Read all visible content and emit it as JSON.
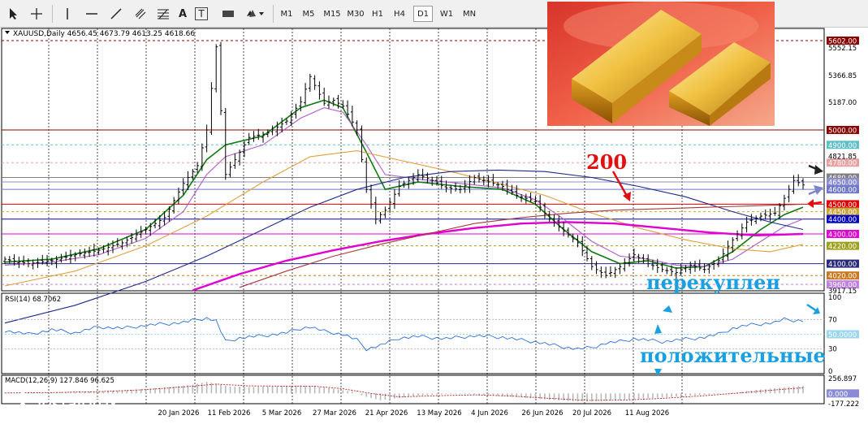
{
  "toolbar": {
    "tools": [
      "cursor-icon",
      "crosshair-icon",
      "vertical-line-icon",
      "horizontal-line-icon",
      "trendline-icon",
      "channel-icon",
      "fibonacci-icon",
      "text-icon",
      "text-label-icon",
      "shapes-icon",
      "arrows-icon"
    ],
    "text_tool": "A",
    "label_tool": "T",
    "timeframes": [
      "M1",
      "M5",
      "M15",
      "M30",
      "H1",
      "H4",
      "D1",
      "W1",
      "MN"
    ],
    "active_timeframe": "D1"
  },
  "header": {
    "symbol_text": "XAUUSD,Daily  4656.45 4673.79 4613.25 4618.66",
    "rsi_text": "RSI(14) 68.7062",
    "macd_text": "MACD(12,26,9) 127.846 96.625"
  },
  "annotations": {
    "ma_label": "200",
    "overbought": "перекуплен",
    "positive": "положительные"
  },
  "logo": {
    "title": "instaforex",
    "subtitle": "Instant Forex Trading"
  },
  "colors": {
    "ohlc": "#000000",
    "ema_fast": "#0f7a0f",
    "ema_slow": "#b15cc9",
    "sma_orange": "#e0a040",
    "ma200_blue": "#1c2a8a",
    "ma_magenta": "#e000d0",
    "ma_brown": "#a83a3a",
    "rsi_line": "#2a6fd6",
    "macd_signal": "#b22222",
    "annot_red": "#e01010",
    "annot_blue": "#1aa0e0"
  },
  "chart_data": {
    "type": "line",
    "symbol": "XAUUSD",
    "timeframe": "Daily",
    "x_axis_labels": [
      "20 Jan 2026",
      "11 Feb 2026",
      "5 Mar 2026",
      "27 Mar 2026",
      "21 Apr 2026",
      "13 May 2026",
      "4 Jun 2026",
      "26 Jun 2026",
      "20 Jul 2026",
      "11 Aug 2026"
    ],
    "ylim": [
      3917.15,
      5640
    ],
    "y_tick_labels": [
      "5552.15",
      "5366.85",
      "5187.00",
      "4821.85",
      "3917.15"
    ],
    "levels": [
      {
        "label": "5602.00",
        "value": 5602,
        "color": "#8b0000",
        "bg": "#8b0000",
        "style": "dash"
      },
      {
        "label": "5000.00",
        "value": 5000,
        "color": "#8b0000",
        "bg": "#8b0000",
        "style": "solid"
      },
      {
        "label": "4900.00",
        "value": 4900,
        "color": "#5fc0c8",
        "bg": "#5fc0c8",
        "style": "dash"
      },
      {
        "label": "4780.00",
        "value": 4780,
        "color": "#e8a0a0",
        "bg": "#e8a0a0",
        "style": "dash"
      },
      {
        "label": "4680.00",
        "value": 4680,
        "color": "#808080",
        "bg": "#808080",
        "style": "solid"
      },
      {
        "label": "4650.00",
        "value": 4650,
        "color": "#8c8cd0",
        "bg": "#8c8cd0",
        "style": "solid"
      },
      {
        "label": "4600.00",
        "value": 4600,
        "color": "#6f77c8",
        "bg": "#6f77c8",
        "style": "solid"
      },
      {
        "label": "4500.00",
        "value": 4500,
        "color": "#e00000",
        "bg": "#e00000",
        "style": "solid"
      },
      {
        "label": "4450.00",
        "value": 4450,
        "color": "#c9a63b",
        "bg": "#c9a63b",
        "style": "dash"
      },
      {
        "label": "4400.00",
        "value": 4400,
        "color": "#0000c0",
        "bg": "#0000c0",
        "style": "solid"
      },
      {
        "label": "4300.00",
        "value": 4300,
        "color": "#e000d0",
        "bg": "#e000d0",
        "style": "solid"
      },
      {
        "label": "4220.00",
        "value": 4220,
        "color": "#a0a020",
        "bg": "#a0a020",
        "style": "dash"
      },
      {
        "label": "4100.00",
        "value": 4100,
        "color": "#2a2a7a",
        "bg": "#2a2a7a",
        "style": "solid"
      },
      {
        "label": "4020.00",
        "value": 4020,
        "color": "#c97a20",
        "bg": "#c97a20",
        "style": "dash"
      },
      {
        "label": "3960.00",
        "value": 3960,
        "color": "#c080e0",
        "bg": "#c080e0",
        "style": "dash"
      }
    ],
    "close_path": [
      [
        0,
        4130
      ],
      [
        5,
        4100
      ],
      [
        10,
        4120
      ],
      [
        15,
        4160
      ],
      [
        20,
        4190
      ],
      [
        25,
        4240
      ],
      [
        30,
        4330
      ],
      [
        34,
        4410
      ],
      [
        38,
        4640
      ],
      [
        41,
        4760
      ],
      [
        43,
        5000
      ],
      [
        45,
        5560
      ],
      [
        47,
        4700
      ],
      [
        49,
        4800
      ],
      [
        52,
        4950
      ],
      [
        56,
        4980
      ],
      [
        60,
        5060
      ],
      [
        63,
        5190
      ],
      [
        65,
        5360
      ],
      [
        68,
        5180
      ],
      [
        70,
        5200
      ],
      [
        72,
        5160
      ],
      [
        75,
        5000
      ],
      [
        77,
        4600
      ],
      [
        79,
        4400
      ],
      [
        81,
        4460
      ],
      [
        84,
        4620
      ],
      [
        88,
        4700
      ],
      [
        91,
        4660
      ],
      [
        94,
        4610
      ],
      [
        97,
        4600
      ],
      [
        100,
        4680
      ],
      [
        103,
        4650
      ],
      [
        106,
        4620
      ],
      [
        109,
        4560
      ],
      [
        113,
        4520
      ],
      [
        116,
        4400
      ],
      [
        119,
        4320
      ],
      [
        122,
        4240
      ],
      [
        125,
        4080
      ],
      [
        128,
        4020
      ],
      [
        131,
        4080
      ],
      [
        134,
        4160
      ],
      [
        137,
        4100
      ],
      [
        140,
        4060
      ],
      [
        143,
        4040
      ],
      [
        146,
        4090
      ],
      [
        149,
        4060
      ],
      [
        152,
        4120
      ],
      [
        155,
        4260
      ],
      [
        158,
        4380
      ],
      [
        161,
        4420
      ],
      [
        164,
        4440
      ],
      [
        166,
        4540
      ],
      [
        168,
        4660
      ],
      [
        170,
        4630
      ]
    ],
    "series": [
      {
        "name": "EMA fast",
        "color": "#0f7a0f",
        "points": [
          [
            0,
            4110
          ],
          [
            10,
            4130
          ],
          [
            20,
            4200
          ],
          [
            30,
            4330
          ],
          [
            38,
            4560
          ],
          [
            43,
            4800
          ],
          [
            47,
            4900
          ],
          [
            55,
            4960
          ],
          [
            63,
            5150
          ],
          [
            68,
            5200
          ],
          [
            72,
            5150
          ],
          [
            77,
            4850
          ],
          [
            81,
            4600
          ],
          [
            88,
            4650
          ],
          [
            97,
            4620
          ],
          [
            106,
            4600
          ],
          [
            113,
            4500
          ],
          [
            119,
            4330
          ],
          [
            125,
            4180
          ],
          [
            131,
            4100
          ],
          [
            137,
            4120
          ],
          [
            143,
            4070
          ],
          [
            149,
            4080
          ],
          [
            155,
            4180
          ],
          [
            161,
            4330
          ],
          [
            166,
            4430
          ],
          [
            170,
            4480
          ]
        ]
      },
      {
        "name": "EMA slow",
        "color": "#b15cc9",
        "points": [
          [
            0,
            4090
          ],
          [
            10,
            4110
          ],
          [
            20,
            4160
          ],
          [
            30,
            4270
          ],
          [
            38,
            4450
          ],
          [
            43,
            4700
          ],
          [
            47,
            4820
          ],
          [
            55,
            4900
          ],
          [
            63,
            5080
          ],
          [
            68,
            5150
          ],
          [
            72,
            5120
          ],
          [
            77,
            4900
          ],
          [
            81,
            4700
          ],
          [
            88,
            4670
          ],
          [
            97,
            4640
          ],
          [
            106,
            4610
          ],
          [
            113,
            4530
          ],
          [
            119,
            4400
          ],
          [
            125,
            4250
          ],
          [
            131,
            4150
          ],
          [
            137,
            4130
          ],
          [
            143,
            4090
          ],
          [
            149,
            4080
          ],
          [
            155,
            4130
          ],
          [
            161,
            4250
          ],
          [
            166,
            4350
          ],
          [
            170,
            4400
          ]
        ]
      },
      {
        "name": "SMA orange",
        "color": "#e0a040",
        "points": [
          [
            0,
            3950
          ],
          [
            15,
            4050
          ],
          [
            30,
            4220
          ],
          [
            43,
            4420
          ],
          [
            55,
            4650
          ],
          [
            65,
            4820
          ],
          [
            75,
            4860
          ],
          [
            85,
            4790
          ],
          [
            95,
            4720
          ],
          [
            105,
            4640
          ],
          [
            115,
            4560
          ],
          [
            125,
            4440
          ],
          [
            135,
            4340
          ],
          [
            145,
            4260
          ],
          [
            155,
            4200
          ],
          [
            163,
            4180
          ],
          [
            170,
            4230
          ]
        ]
      },
      {
        "name": "MA blue",
        "color": "#1c2a8a",
        "points": [
          [
            0,
            3700
          ],
          [
            15,
            3820
          ],
          [
            30,
            3980
          ],
          [
            43,
            4150
          ],
          [
            55,
            4330
          ],
          [
            65,
            4480
          ],
          [
            75,
            4600
          ],
          [
            85,
            4680
          ],
          [
            95,
            4720
          ],
          [
            105,
            4730
          ],
          [
            115,
            4720
          ],
          [
            125,
            4680
          ],
          [
            135,
            4620
          ],
          [
            145,
            4550
          ],
          [
            155,
            4450
          ],
          [
            163,
            4380
          ],
          [
            170,
            4330
          ]
        ]
      },
      {
        "name": "MA magenta",
        "color": "#e000d0",
        "points": [
          [
            40,
            3920
          ],
          [
            50,
            4030
          ],
          [
            60,
            4120
          ],
          [
            70,
            4190
          ],
          [
            80,
            4250
          ],
          [
            90,
            4300
          ],
          [
            100,
            4340
          ],
          [
            110,
            4370
          ],
          [
            120,
            4380
          ],
          [
            130,
            4370
          ],
          [
            140,
            4340
          ],
          [
            150,
            4310
          ],
          [
            160,
            4290
          ],
          [
            170,
            4300
          ]
        ]
      },
      {
        "name": "MA brown",
        "color": "#a83a3a",
        "points": [
          [
            50,
            3940
          ],
          [
            60,
            4050
          ],
          [
            70,
            4150
          ],
          [
            80,
            4230
          ],
          [
            90,
            4300
          ],
          [
            100,
            4370
          ],
          [
            110,
            4410
          ],
          [
            120,
            4440
          ],
          [
            130,
            4460
          ],
          [
            140,
            4470
          ],
          [
            150,
            4480
          ],
          [
            160,
            4490
          ],
          [
            170,
            4500
          ]
        ]
      }
    ],
    "rsi": {
      "title": "RSI(14) 68.7062",
      "ylim": [
        0,
        100
      ],
      "ticks": [
        "100",
        "70",
        "50.0000",
        "30",
        "0"
      ],
      "levels": [
        70,
        50,
        30
      ],
      "values": [
        [
          0,
          55
        ],
        [
          5,
          50
        ],
        [
          10,
          56
        ],
        [
          15,
          52
        ],
        [
          20,
          60
        ],
        [
          25,
          58
        ],
        [
          30,
          62
        ],
        [
          34,
          64
        ],
        [
          38,
          66
        ],
        [
          41,
          70
        ],
        [
          43,
          72
        ],
        [
          45,
          68
        ],
        [
          47,
          40
        ],
        [
          50,
          45
        ],
        [
          55,
          48
        ],
        [
          60,
          52
        ],
        [
          63,
          58
        ],
        [
          65,
          60
        ],
        [
          68,
          54
        ],
        [
          72,
          50
        ],
        [
          75,
          42
        ],
        [
          77,
          30
        ],
        [
          80,
          35
        ],
        [
          84,
          45
        ],
        [
          88,
          47
        ],
        [
          94,
          44
        ],
        [
          100,
          48
        ],
        [
          106,
          46
        ],
        [
          110,
          42
        ],
        [
          113,
          40
        ],
        [
          116,
          36
        ],
        [
          119,
          33
        ],
        [
          122,
          30
        ],
        [
          125,
          32
        ],
        [
          128,
          38
        ],
        [
          131,
          40
        ],
        [
          134,
          44
        ],
        [
          137,
          42
        ],
        [
          140,
          40
        ],
        [
          143,
          42
        ],
        [
          146,
          44
        ],
        [
          149,
          46
        ],
        [
          152,
          50
        ],
        [
          155,
          58
        ],
        [
          158,
          62
        ],
        [
          161,
          64
        ],
        [
          164,
          66
        ],
        [
          166,
          70
        ],
        [
          168,
          69
        ],
        [
          170,
          68.7
        ]
      ]
    },
    "macd": {
      "title": "MACD(12,26,9) 127.846 96.625",
      "ylim": [
        -177.222,
        256.897
      ],
      "ticks": [
        "256.897",
        "0.000",
        "-177.222"
      ],
      "values": [
        [
          0,
          10
        ],
        [
          5,
          12
        ],
        [
          10,
          18
        ],
        [
          15,
          24
        ],
        [
          20,
          38
        ],
        [
          25,
          50
        ],
        [
          30,
          80
        ],
        [
          35,
          110
        ],
        [
          40,
          150
        ],
        [
          43,
          200
        ],
        [
          45,
          170
        ],
        [
          48,
          120
        ],
        [
          52,
          110
        ],
        [
          56,
          120
        ],
        [
          60,
          130
        ],
        [
          63,
          140
        ],
        [
          66,
          120
        ],
        [
          70,
          80
        ],
        [
          74,
          30
        ],
        [
          77,
          -60
        ],
        [
          80,
          -120
        ],
        [
          84,
          -80
        ],
        [
          88,
          -40
        ],
        [
          92,
          -20
        ],
        [
          96,
          -10
        ],
        [
          100,
          -20
        ],
        [
          104,
          -40
        ],
        [
          108,
          -60
        ],
        [
          112,
          -80
        ],
        [
          116,
          -110
        ],
        [
          120,
          -130
        ],
        [
          124,
          -140
        ],
        [
          128,
          -130
        ],
        [
          132,
          -110
        ],
        [
          136,
          -90
        ],
        [
          140,
          -70
        ],
        [
          144,
          -50
        ],
        [
          148,
          -30
        ],
        [
          152,
          -10
        ],
        [
          156,
          20
        ],
        [
          160,
          60
        ],
        [
          164,
          90
        ],
        [
          168,
          120
        ],
        [
          170,
          128
        ]
      ],
      "signal": [
        [
          0,
          8
        ],
        [
          10,
          15
        ],
        [
          20,
          30
        ],
        [
          30,
          65
        ],
        [
          40,
          125
        ],
        [
          45,
          160
        ],
        [
          52,
          130
        ],
        [
          60,
          125
        ],
        [
          66,
          125
        ],
        [
          72,
          80
        ],
        [
          78,
          0
        ],
        [
          84,
          -60
        ],
        [
          92,
          -40
        ],
        [
          100,
          -25
        ],
        [
          108,
          -45
        ],
        [
          116,
          -85
        ],
        [
          124,
          -120
        ],
        [
          132,
          -115
        ],
        [
          140,
          -85
        ],
        [
          148,
          -45
        ],
        [
          156,
          5
        ],
        [
          164,
          60
        ],
        [
          170,
          97
        ]
      ]
    }
  }
}
